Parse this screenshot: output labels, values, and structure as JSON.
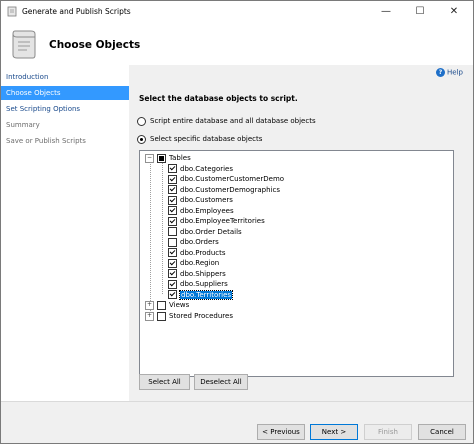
{
  "window": {
    "title": "Generate and Publish Scripts",
    "minimize_glyph": "—",
    "maximize_glyph": "☐",
    "close_glyph": "✕"
  },
  "header": {
    "title": "Choose Objects"
  },
  "nav": {
    "items": [
      {
        "label": "Introduction",
        "state": "normal"
      },
      {
        "label": "Choose Objects",
        "state": "active"
      },
      {
        "label": "Set Scripting Options",
        "state": "normal"
      },
      {
        "label": "Summary",
        "state": "disabled"
      },
      {
        "label": "Save or Publish Scripts",
        "state": "disabled"
      }
    ]
  },
  "content": {
    "help_label": "Help",
    "help_glyph": "?",
    "instruction": "Select the database objects to script.",
    "radio_entire": "Script entire database and all database objects",
    "radio_specific": "Select specific database objects"
  },
  "tree": {
    "expanded_glyph": "−",
    "collapsed_glyph": "+",
    "tables_label": "Tables",
    "tables": [
      {
        "name": "dbo.Categories",
        "checked": true
      },
      {
        "name": "dbo.CustomerCustomerDemo",
        "checked": true
      },
      {
        "name": "dbo.CustomerDemographics",
        "checked": true
      },
      {
        "name": "dbo.Customers",
        "checked": true
      },
      {
        "name": "dbo.Employees",
        "checked": true
      },
      {
        "name": "dbo.EmployeeTerritories",
        "checked": true
      },
      {
        "name": "dbo.Order Details",
        "checked": false
      },
      {
        "name": "dbo.Orders",
        "checked": false
      },
      {
        "name": "dbo.Products",
        "checked": true
      },
      {
        "name": "dbo.Region",
        "checked": true
      },
      {
        "name": "dbo.Shippers",
        "checked": true
      },
      {
        "name": "dbo.Suppliers",
        "checked": true
      },
      {
        "name": "dbo.Territories",
        "checked": true,
        "selected": true
      }
    ],
    "views_label": "Views",
    "procs_label": "Stored Procedures"
  },
  "buttons": {
    "select_all": "Select All",
    "deselect_all": "Deselect All",
    "previous": "< Previous",
    "next": "Next >",
    "finish": "Finish",
    "cancel": "Cancel"
  }
}
